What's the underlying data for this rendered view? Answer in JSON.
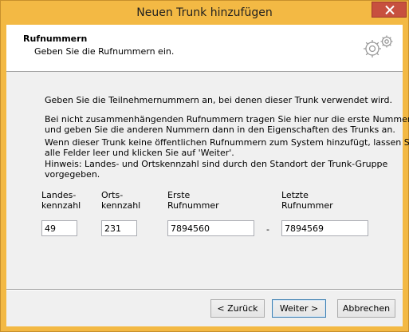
{
  "window": {
    "title": "Neuen Trunk hinzufügen"
  },
  "header": {
    "title": "Rufnummern",
    "subtitle": "Geben Sie die Rufnummern ein."
  },
  "body": {
    "intro": "Geben Sie die Teilnehmernummern an, bei denen dieser Trunk verwendet wird.",
    "para1_line1": "Bei nicht zusammenhängenden Rufnummern tragen Sie hier nur die erste Nummer ein",
    "para1_line2": "und geben Sie die anderen Nummern dann in den Eigenschaften des Trunks an.",
    "para2_line1": "Wenn dieser Trunk keine öffentlichen Rufnummern zum System hinzufügt, lassen Sie",
    "para2_line2": "alle Felder leer und klicken Sie auf 'Weiter'.",
    "para3_line1": "Hinweis: Landes- und Ortskennzahl sind durch den Standort der Trunk-Gruppe",
    "para3_line2": "vorgegeben."
  },
  "fields": {
    "landes_label_1": "Landes-",
    "landes_label_2": "kennzahl",
    "landes_value": "49",
    "orts_label_1": "Orts-",
    "orts_label_2": "kennzahl",
    "orts_value": "231",
    "erste_label_1": "Erste",
    "erste_label_2": "Rufnummer",
    "erste_value": "7894560",
    "separator": "-",
    "letzte_label_1": "Letzte",
    "letzte_label_2": "Rufnummer",
    "letzte_value": "7894569"
  },
  "buttons": {
    "back": "< Zurück",
    "next": "Weiter >",
    "cancel": "Abbrechen"
  },
  "colors": {
    "frame": "#f3b944",
    "close": "#c7503f"
  },
  "icons": {
    "header_icon": "gears-icon",
    "close_icon": "close-icon"
  }
}
